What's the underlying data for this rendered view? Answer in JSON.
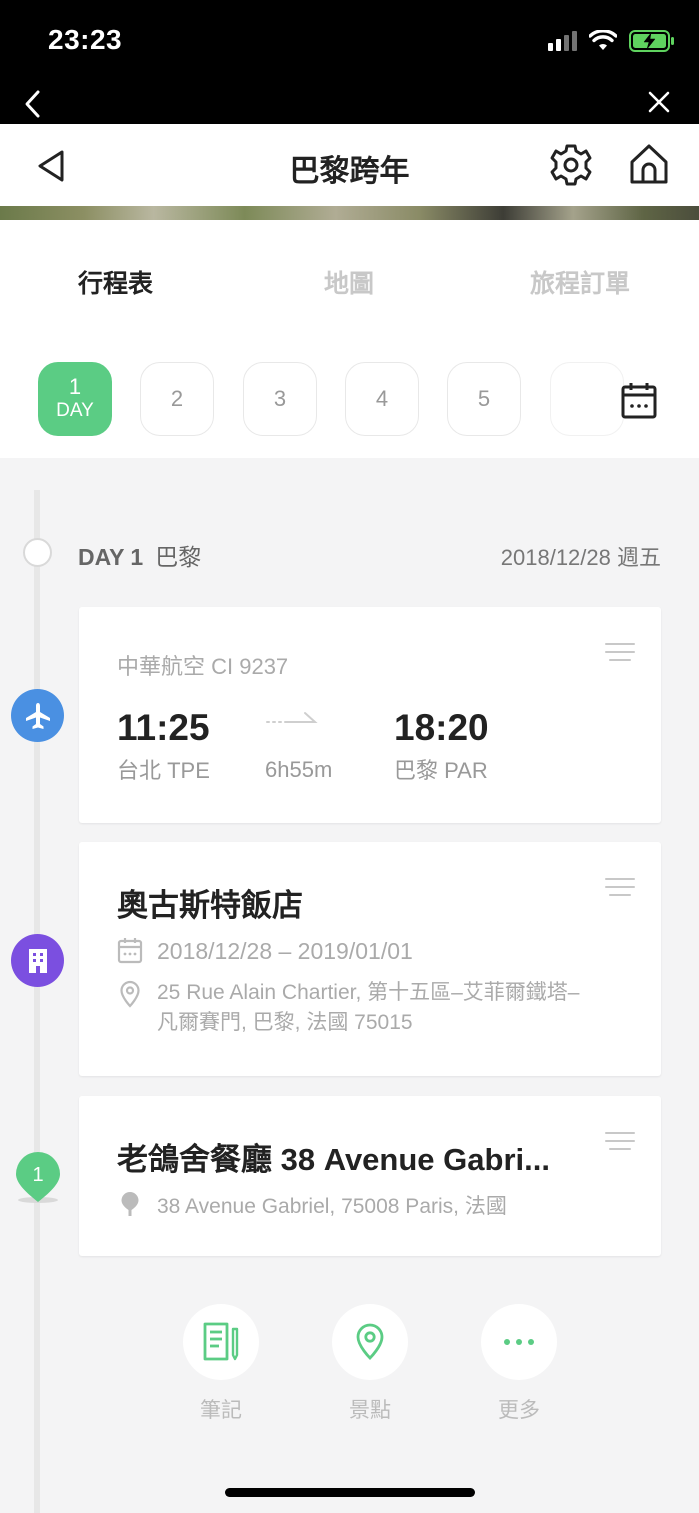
{
  "status_bar": {
    "time": "23:23"
  },
  "nav": {
    "title": "巴黎跨年"
  },
  "tabs": [
    "行程表",
    "地圖",
    "旅程訂單"
  ],
  "days": {
    "active_number": "1",
    "active_label": "DAY",
    "others": [
      "2",
      "3",
      "4",
      "5"
    ]
  },
  "day_header": {
    "label": "DAY 1",
    "city": "巴黎",
    "date": "2018/12/28 週五"
  },
  "flight": {
    "airline": "中華航空 CI 9237",
    "dep_time": "11:25",
    "dep_place": "台北 TPE",
    "duration": "6h55m",
    "arr_time": "18:20",
    "arr_place": "巴黎 PAR"
  },
  "hotel": {
    "name": "奧古斯特飯店",
    "dates": "2018/12/28 – 2019/01/01",
    "address": "25 Rue Alain Chartier, 第十五區–艾菲爾鐵塔–凡爾賽門, 巴黎, 法國 75015"
  },
  "restaurant": {
    "marker_number": "1",
    "name": "老鴿舍餐廳 38 Avenue Gabri...",
    "address": "38 Avenue Gabriel, 75008 Paris, 法國"
  },
  "actions": [
    "筆記",
    "景點",
    "更多"
  ],
  "colors": {
    "accent_green": "#5bcc84",
    "flight_blue": "#4a90e2",
    "hotel_purple": "#7b4fe0"
  }
}
